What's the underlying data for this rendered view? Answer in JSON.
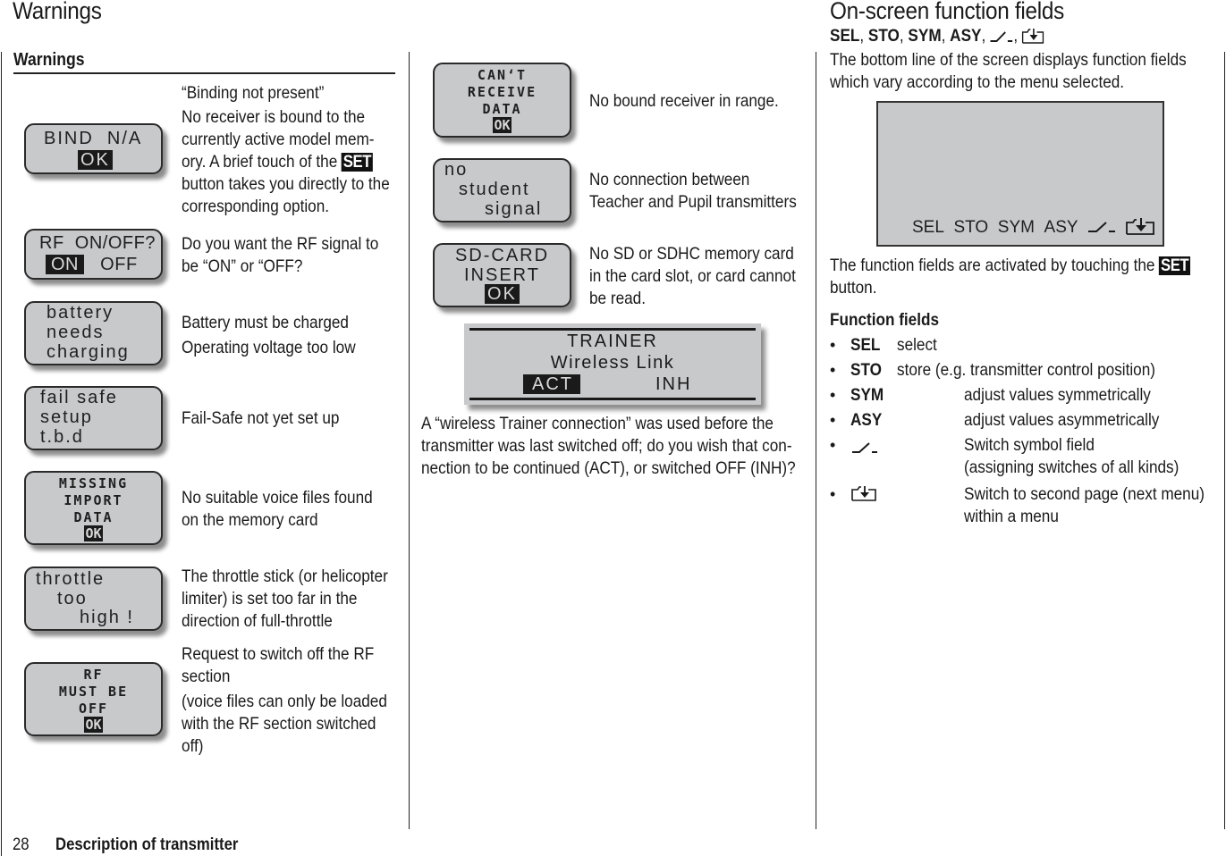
{
  "page": {
    "header_left": "Warnings",
    "header_right": "On-screen function fields",
    "footer_page_number": "28",
    "footer_title": "Description of transmitter"
  },
  "warnings_section": {
    "heading": "Warnings",
    "items": [
      {
        "lcd_lines": [
          "BIND  N/A"
        ],
        "lcd_highlight": "OK",
        "desc_title": "“Binding not present”",
        "desc_lines": [
          "No receiver is bound to the",
          "currently active model mem-",
          "ory. A brief touch of the",
          "button takes you directly to the",
          "corresponding option."
        ],
        "set_label": "SET"
      },
      {
        "lcd_line1": "RF  ON/OFF?",
        "lcd_highlight": "ON",
        "lcd_option": "OFF",
        "desc_lines": [
          "Do you want the RF signal to",
          "be “ON” or “OFF?"
        ]
      },
      {
        "lcd_lines": [
          "battery",
          "needs",
          "charging"
        ],
        "desc_lines": [
          "Battery must be charged",
          "Operating voltage too low"
        ]
      },
      {
        "lcd_lines": [
          "fail safe",
          "setup",
          "t.b.d"
        ],
        "desc_lines": [
          "Fail-Safe not yet set up"
        ]
      },
      {
        "lcd_lines": [
          "MISSING",
          "IMPORT",
          "DATA"
        ],
        "lcd_highlight": "OK",
        "desc_lines": [
          "No suitable voice files found",
          "on the memory card"
        ]
      },
      {
        "lcd_lines": [
          "throttle",
          "too",
          "high !"
        ],
        "desc_lines": [
          "The throttle stick (or helicopter",
          "limiter) is set too far in the",
          "direction of full-throttle"
        ]
      },
      {
        "lcd_lines": [
          "RF",
          "MUST BE",
          "OFF"
        ],
        "lcd_highlight": "OK",
        "desc_lines": [
          "Request to switch off the RF",
          "section",
          "(voice files can only be loaded",
          "with the RF section switched",
          "off)"
        ]
      }
    ]
  },
  "middle_column": {
    "items": [
      {
        "lcd_lines": [
          "CAN‘T",
          "RECEIVE",
          "DATA"
        ],
        "lcd_highlight": "OK",
        "desc_lines": [
          "No bound receiver in range."
        ]
      },
      {
        "lcd_lines": [
          "no",
          "student",
          "signal"
        ],
        "desc_lines": [
          "No connection between",
          "Teacher and Pupil transmitters"
        ]
      },
      {
        "lcd_lines": [
          "SD-CARD",
          "INSERT"
        ],
        "lcd_highlight": "OK",
        "desc_lines": [
          "No SD or SDHC memory card",
          "in the card slot, or card cannot",
          "be read."
        ]
      }
    ],
    "trainer": {
      "title": "TRAINER",
      "subtitle": "Wireless Link",
      "option_active": "ACT",
      "option_inactive": "INH",
      "desc_lines": [
        "A “wireless Trainer connection” was used before the",
        "transmitter was last switched off; do you wish that con-",
        "nection to be continued (ACT), or switched OFF (INH)?"
      ]
    }
  },
  "function_fields_section": {
    "subtitle_keys": [
      "SEL",
      "STO",
      "SYM",
      "ASY"
    ],
    "intro_lines": [
      "The bottom line of the screen displays function fields",
      "which vary according to the menu selected."
    ],
    "screen_fields": [
      "SEL",
      "STO",
      "SYM",
      "ASY"
    ],
    "screen_icons": [
      "switch-symbol",
      "next-page"
    ],
    "activation_text": "The function fields are activated by touching the",
    "activation_set": "SET",
    "activation_end": "button.",
    "list_heading": "Function fields",
    "list": [
      {
        "key": "SEL",
        "icon": null,
        "desc": [
          "select"
        ]
      },
      {
        "key": "STO",
        "icon": null,
        "desc": [
          "store (e.g. transmitter control position)"
        ]
      },
      {
        "key": "SYM",
        "icon": null,
        "desc": [
          "adjust values symmetrically"
        ]
      },
      {
        "key": "ASY",
        "icon": null,
        "desc": [
          "adjust values asymmetrically"
        ]
      },
      {
        "key": "",
        "icon": "switch-symbol",
        "desc": [
          "Switch symbol field",
          "(assigning switches of all kinds)"
        ]
      },
      {
        "key": "",
        "icon": "next-page",
        "desc": [
          "Switch to second page (next menu)",
          "within a menu"
        ]
      }
    ]
  }
}
